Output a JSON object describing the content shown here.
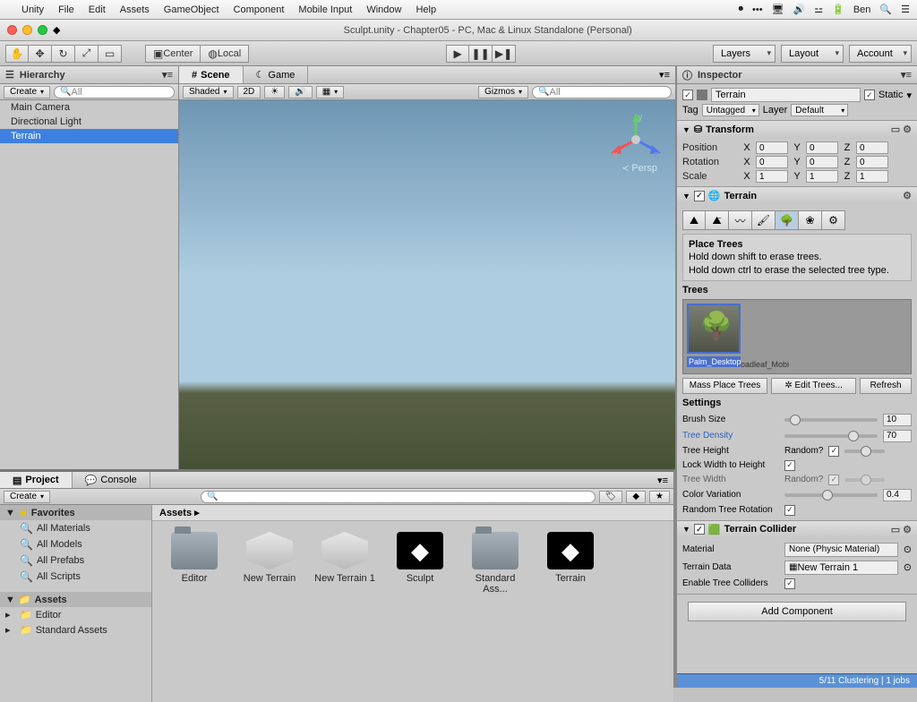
{
  "menubar": {
    "items": [
      "Unity",
      "File",
      "Edit",
      "Assets",
      "GameObject",
      "Component",
      "Mobile Input",
      "Window",
      "Help"
    ],
    "user": "Ben"
  },
  "window": {
    "title": "Sculpt.unity - Chapter05 - PC, Mac & Linux Standalone (Personal)"
  },
  "toolbar": {
    "center": "Center",
    "local": "Local",
    "layers": "Layers",
    "layout": "Layout",
    "account": "Account"
  },
  "hierarchy": {
    "title": "Hierarchy",
    "create": "Create",
    "search": "All",
    "items": [
      "Main Camera",
      "Directional Light",
      "Terrain"
    ],
    "selected": 2
  },
  "scene": {
    "tabs": [
      "Scene",
      "Game"
    ],
    "active": 0,
    "shading": "Shaded",
    "twod": "2D",
    "gizmos": "Gizmos",
    "search": "All",
    "persp": "Persp"
  },
  "project": {
    "tabs": [
      "Project",
      "Console"
    ],
    "create": "Create",
    "favorites_label": "Favorites",
    "favorites": [
      "All Materials",
      "All Models",
      "All Prefabs",
      "All Scripts"
    ],
    "assets_label": "Assets",
    "assets_tree": [
      "Editor",
      "Standard Assets"
    ],
    "breadcrumb": "Assets ▸",
    "grid": [
      {
        "name": "Editor",
        "type": "folder"
      },
      {
        "name": "New Terrain",
        "type": "box"
      },
      {
        "name": "New Terrain 1",
        "type": "box"
      },
      {
        "name": "Sculpt",
        "type": "unity"
      },
      {
        "name": "Standard Ass...",
        "type": "folder"
      },
      {
        "name": "Terrain",
        "type": "unity"
      }
    ]
  },
  "inspector": {
    "title": "Inspector",
    "obj_enabled": true,
    "obj_name": "Terrain",
    "static_label": "Static",
    "static": true,
    "tag_label": "Tag",
    "tag": "Untagged",
    "layer_label": "Layer",
    "layer": "Default",
    "transform": {
      "title": "Transform",
      "rows": [
        {
          "label": "Position",
          "x": "0",
          "y": "0",
          "z": "0"
        },
        {
          "label": "Rotation",
          "x": "0",
          "y": "0",
          "z": "0"
        },
        {
          "label": "Scale",
          "x": "1",
          "y": "1",
          "z": "1"
        }
      ]
    },
    "terrain": {
      "title": "Terrain",
      "section": "Place Trees",
      "hint1": "Hold down shift to erase trees.",
      "hint2": "Hold down ctrl to erase the selected tree type.",
      "trees_label": "Trees",
      "tree_name": "Palm_Desktop",
      "tree_name2": "oadleaf_Mobi",
      "mass_place": "Mass Place Trees",
      "edit_trees": "✲ Edit Trees...",
      "refresh": "Refresh",
      "settings_label": "Settings",
      "brush_size_label": "Brush Size",
      "brush_size": "10",
      "tree_density_label": "Tree Density",
      "tree_density": "70",
      "tree_height_label": "Tree Height",
      "random_q": "Random?",
      "lock_label": "Lock Width to Height",
      "tree_width_label": "Tree Width",
      "color_var_label": "Color Variation",
      "color_var": "0.4",
      "random_rot_label": "Random Tree Rotation"
    },
    "collider": {
      "title": "Terrain Collider",
      "material_label": "Material",
      "material": "None (Physic Material)",
      "terrain_data_label": "Terrain Data",
      "terrain_data": "New Terrain 1",
      "enable_tree_label": "Enable Tree Colliders"
    },
    "add_component": "Add Component"
  },
  "statusbar": {
    "text": "5/11 Clustering | 1 jobs"
  }
}
